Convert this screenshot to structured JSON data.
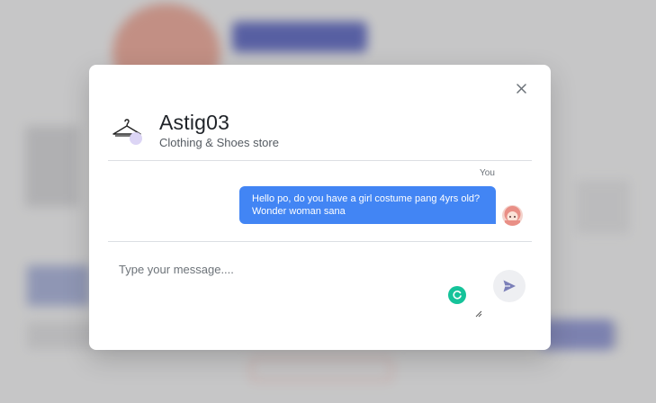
{
  "modal": {
    "store": {
      "name": "Astig03",
      "category": "Clothing & Shoes store",
      "avatar_icon": "clothes-hanger-icon"
    },
    "close_icon": "close-icon",
    "messages": [
      {
        "sender_label": "You",
        "text": "Hello po, do you have a girl costume pang 4yrs old? Wonder woman sana",
        "bubble_color": "#4285f4"
      }
    ],
    "composer": {
      "placeholder": "Type your message....",
      "value": "",
      "send_icon": "send-icon",
      "send_icon_color": "#7b7fb8",
      "grammar_icon": "grammarly-icon",
      "grammar_icon_color": "#15c39a"
    }
  }
}
